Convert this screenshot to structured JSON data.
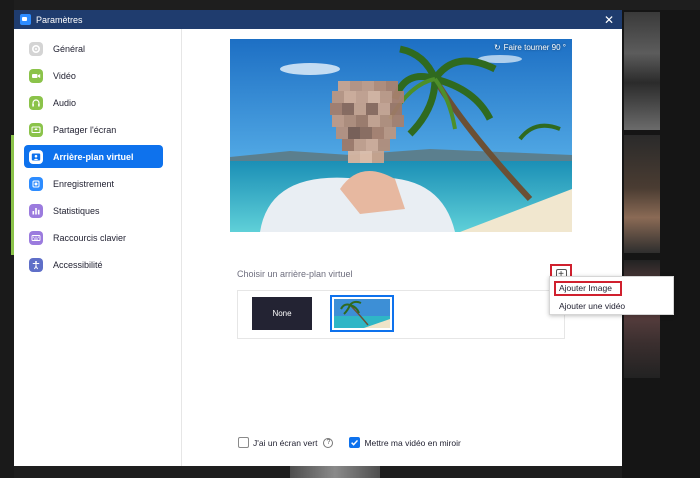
{
  "window": {
    "title": "Paramètres",
    "close_symbol": "✕"
  },
  "sidebar": {
    "items": [
      {
        "label": "Général",
        "icon": "gear-icon",
        "color": "#d4d4d4"
      },
      {
        "label": "Vidéo",
        "icon": "video-icon",
        "color": "#8bc34a"
      },
      {
        "label": "Audio",
        "icon": "headphones-icon",
        "color": "#8bc34a"
      },
      {
        "label": "Partager l'écran",
        "icon": "share-screen-icon",
        "color": "#8bc34a"
      },
      {
        "label": "Arrière-plan virtuel",
        "icon": "person-background-icon",
        "color": "#ffffff",
        "active": true
      },
      {
        "label": "Enregistrement",
        "icon": "record-icon",
        "color": "#2d8cff"
      },
      {
        "label": "Statistiques",
        "icon": "statistics-icon",
        "color": "#9b7bde"
      },
      {
        "label": "Raccourcis clavier",
        "icon": "keyboard-icon",
        "color": "#9b7bde"
      },
      {
        "label": "Accessibilité",
        "icon": "accessibility-icon",
        "color": "#5f6fc8"
      }
    ]
  },
  "preview": {
    "rotate_label": "Faire tourner 90 °"
  },
  "background": {
    "section_title": "Choisir un arrière-plan virtuel",
    "none_label": "None",
    "add_symbol": "+"
  },
  "menu": {
    "add_image": "Ajouter Image",
    "add_video": "Ajouter une vidéo"
  },
  "options": {
    "green_screen_label": "J'ai un écran vert",
    "help_symbol": "?",
    "mirror_label": "Mettre ma vidéo en miroir",
    "green_screen_checked": false,
    "mirror_checked": true
  },
  "colors": {
    "accent": "#0e72ed",
    "highlight_border": "#d0202e",
    "titlebar": "#1f3c6e"
  }
}
